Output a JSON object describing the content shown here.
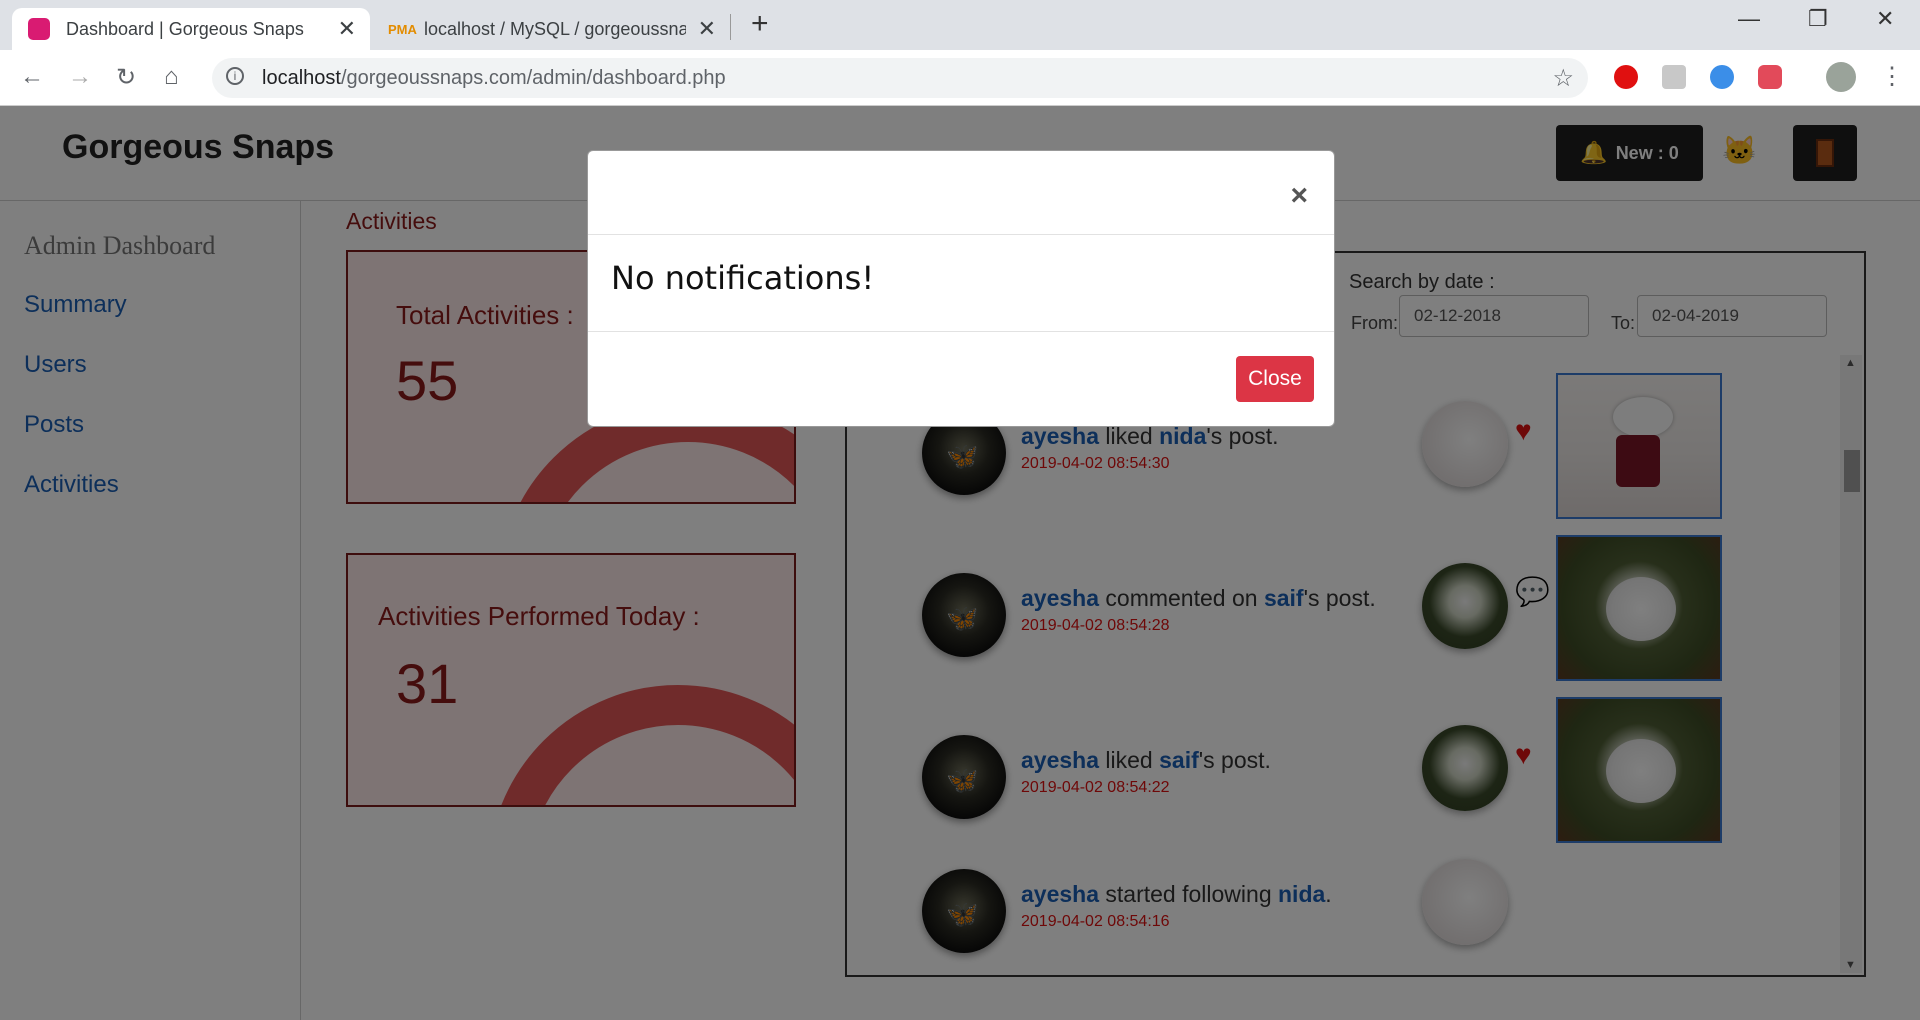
{
  "browser": {
    "tabs": [
      {
        "title": "Dashboard | Gorgeous Snaps",
        "active": true
      },
      {
        "title": "localhost / MySQL / gorgeoussna",
        "active": false
      }
    ],
    "url_host": "localhost",
    "url_path": "/gorgeoussnaps.com/admin/dashboard.php"
  },
  "header": {
    "brand": "Gorgeous Snaps",
    "notif_button": "New : 0"
  },
  "sidebar": {
    "title": "Admin Dashboard",
    "items": [
      {
        "label": "Summary"
      },
      {
        "label": "Users"
      },
      {
        "label": "Posts"
      },
      {
        "label": "Activities"
      }
    ]
  },
  "main": {
    "section_title": "Activities",
    "cards": [
      {
        "label": "Total Activities :",
        "value": "55"
      },
      {
        "label": "Activities Performed Today :",
        "value": "31"
      }
    ],
    "search": {
      "label": "Search by date :",
      "from_label": "From:",
      "from_value": "02-12-2018",
      "to_label": "To:",
      "to_value": "02-04-2019"
    },
    "activities": [
      {
        "user": "ayesha",
        "action": " liked ",
        "target": "nida",
        "suffix": "'s post.",
        "time": "2019-04-02 08:54:30",
        "icon": "heart-icon"
      },
      {
        "user": "ayesha",
        "action": " commented on ",
        "target": "saif",
        "suffix": "'s post.",
        "time": "2019-04-02 08:54:28",
        "icon": "comment-icon"
      },
      {
        "user": "ayesha",
        "action": " liked ",
        "target": "saif",
        "suffix": "'s post.",
        "time": "2019-04-02 08:54:22",
        "icon": "heart-icon"
      },
      {
        "user": "ayesha",
        "action": " started following ",
        "target": "nida",
        "suffix": ".",
        "time": "2019-04-02 08:54:16",
        "icon": ""
      }
    ]
  },
  "modal": {
    "close_symbol": "×",
    "message": "No notifications!",
    "close_button": "Close"
  },
  "colors": {
    "accent": "#dc3545",
    "link": "#1a5fb4",
    "card_text": "#8b1a1a"
  }
}
